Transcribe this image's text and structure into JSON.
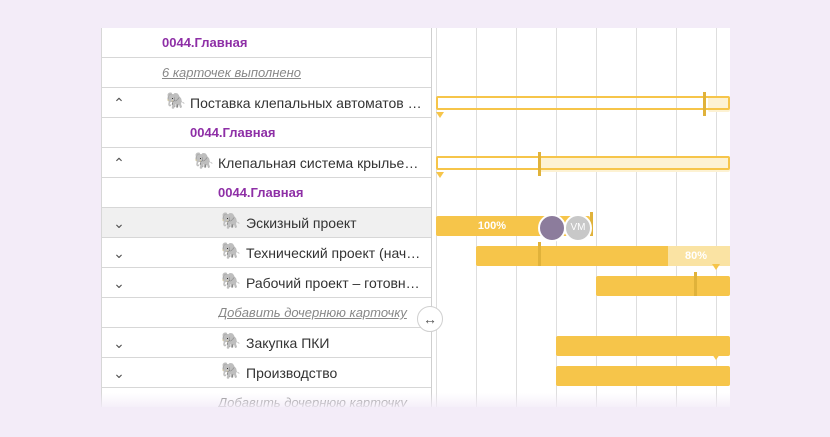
{
  "rows": [
    {
      "label": "0044.Главная",
      "style": "purple",
      "caret": "",
      "icon": ""
    },
    {
      "label": "6 карточек выполнено",
      "style": "link",
      "caret": "",
      "icon": ""
    },
    {
      "label": "Поставка клепальных автоматов …",
      "style": "normal",
      "caret": "^",
      "icon": "🐘"
    },
    {
      "label": "0044.Главная",
      "style": "purple",
      "caret": "",
      "icon": ""
    },
    {
      "label": "Клепальная система крылье…",
      "style": "normal",
      "caret": "^",
      "icon": "🐘"
    },
    {
      "label": "0044.Главная",
      "style": "purple",
      "caret": "",
      "icon": ""
    },
    {
      "label": "Эскизный проект",
      "style": "normal",
      "caret": "⌄",
      "icon": "🐘"
    },
    {
      "label": "Технический проект (нач…",
      "style": "normal",
      "caret": "⌄",
      "icon": "🐘"
    },
    {
      "label": "Рабочий проект – готовн…",
      "style": "normal",
      "caret": "⌄",
      "icon": "🐘"
    },
    {
      "label": "Добавить дочернюю карточку",
      "style": "link",
      "caret": "",
      "icon": ""
    },
    {
      "label": "Закупка ПКИ",
      "style": "normal",
      "caret": "⌄",
      "icon": "🐘"
    },
    {
      "label": "Производство",
      "style": "normal",
      "caret": "⌄",
      "icon": "🐘"
    },
    {
      "label": "Добавить дочернюю карточку",
      "style": "link",
      "caret": "",
      "icon": ""
    }
  ],
  "gantt": {
    "escizny_progress": "100%",
    "technical_progress": "80%",
    "avatar_initials": "VM"
  },
  "resize_icon": "↔"
}
